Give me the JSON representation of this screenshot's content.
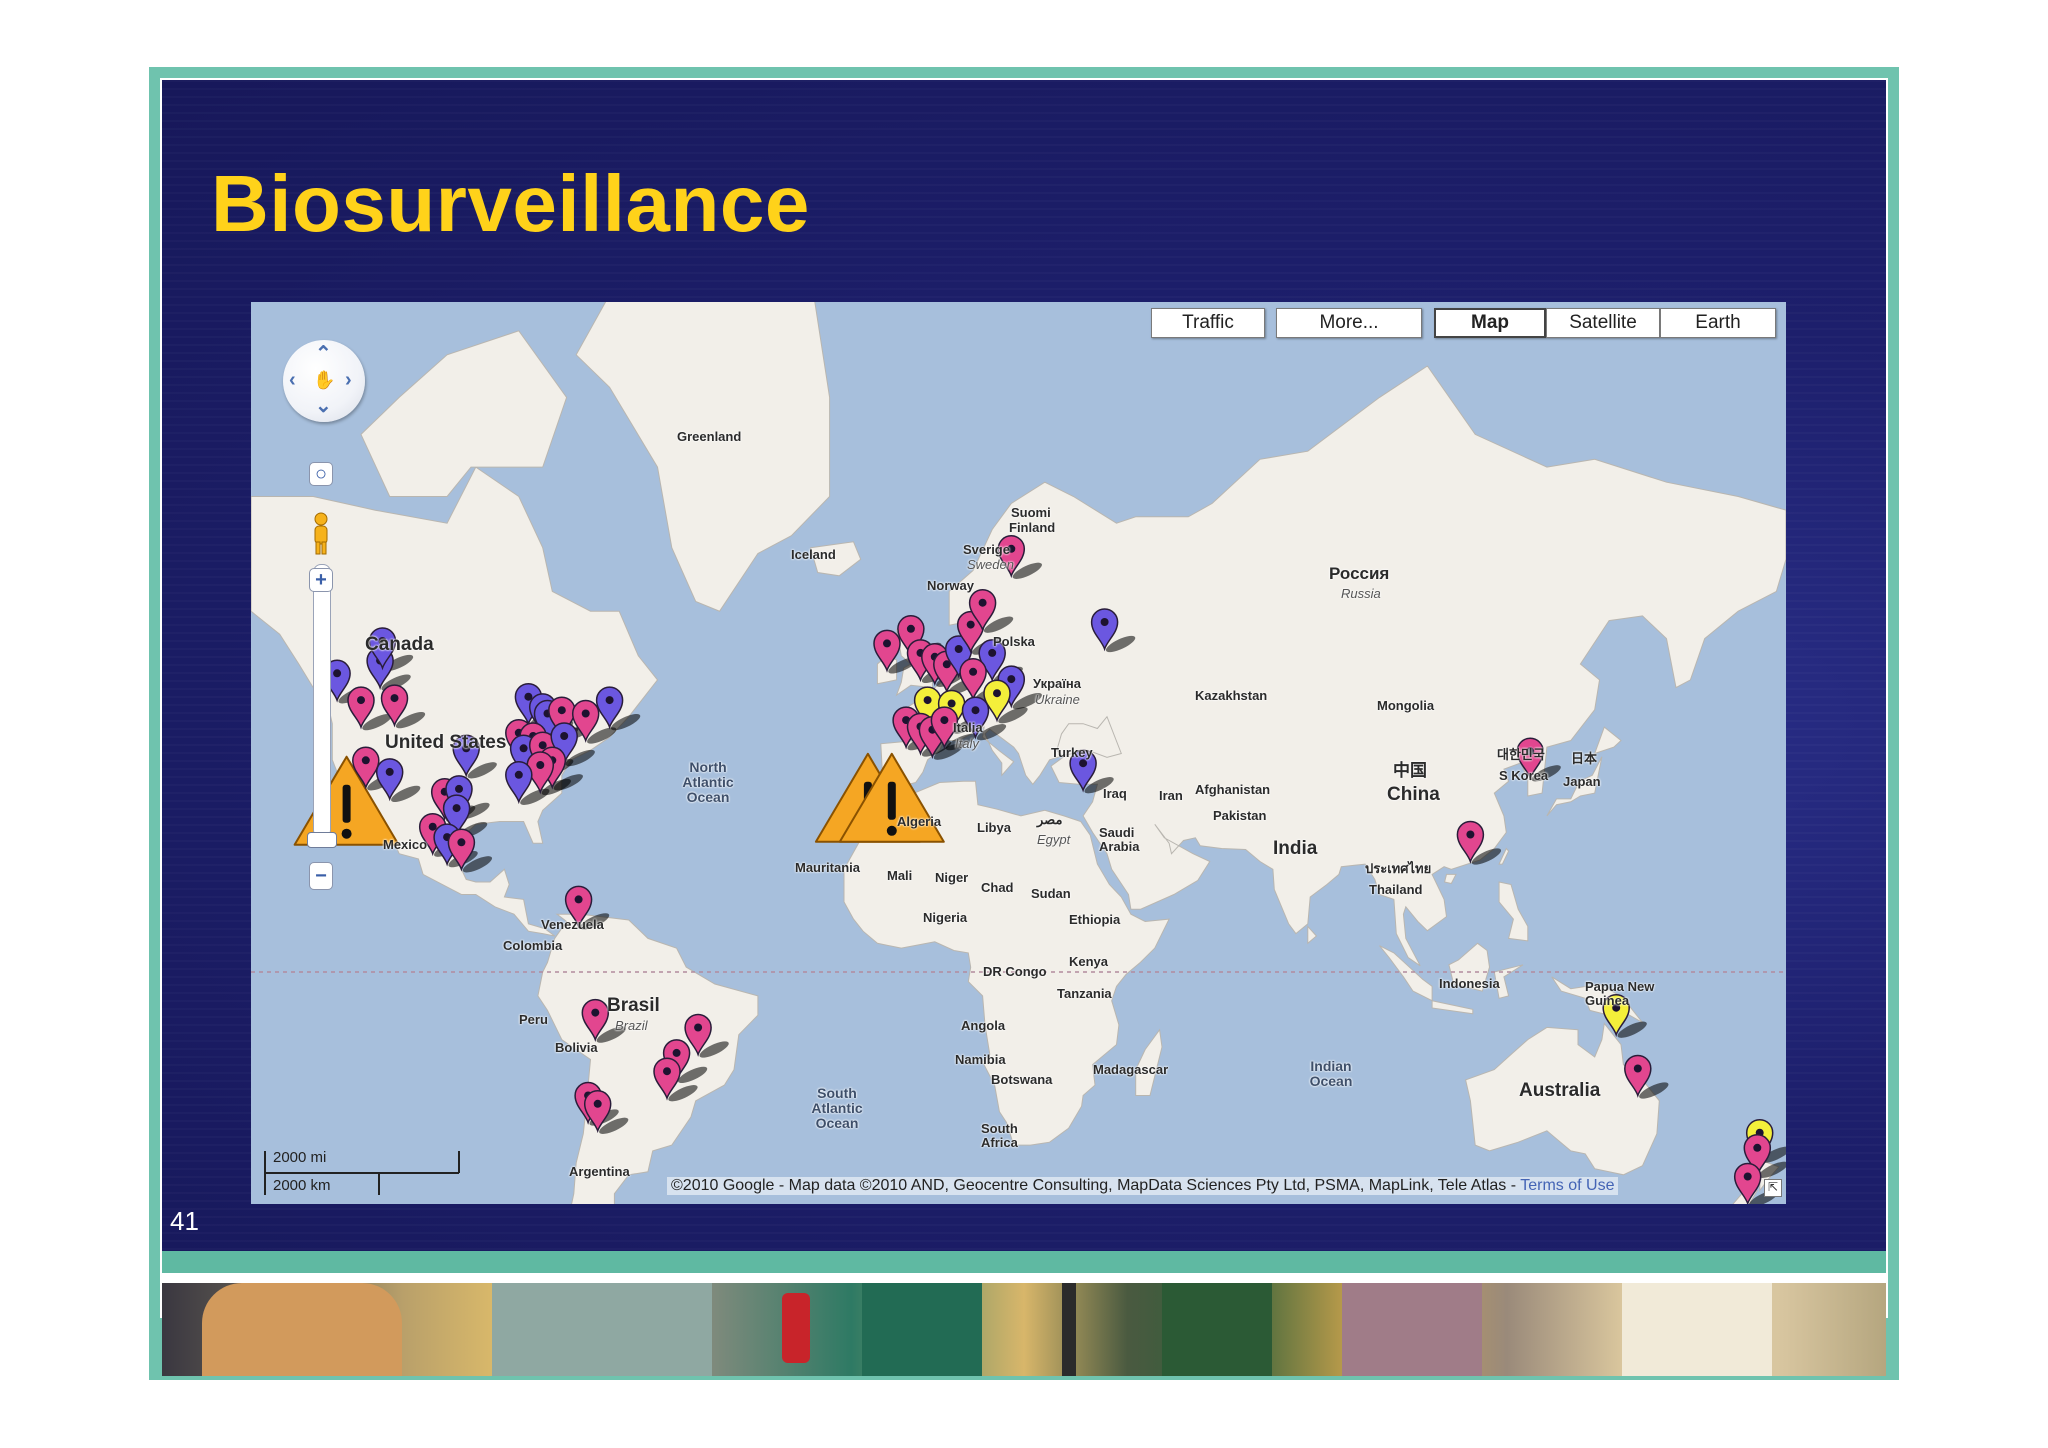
{
  "slide": {
    "title": "Biosurveillance",
    "number": "41"
  },
  "map": {
    "buttons": {
      "traffic": "Traffic",
      "more": "More...",
      "map": "Map",
      "satellite": "Satellite",
      "earth": "Earth",
      "active": "Map"
    },
    "labels": {
      "greenland": "Greenland",
      "iceland": "Iceland",
      "canada": "Canada",
      "united_states": "United States",
      "mexico": "Mexico",
      "venezuela": "Venezuela",
      "colombia": "Colombia",
      "peru": "Peru",
      "bolivia": "Bolivia",
      "brasil": "Brasil",
      "brazil": "Brazil",
      "argentina": "Argentina",
      "north_atlantic": "North Atlantic Ocean",
      "south_atlantic": "South Atlantic Ocean",
      "suomi": "Suomi",
      "finland": "Finland",
      "sverige": "Sverige",
      "sweden": "Sweden",
      "norway": "Norway",
      "polska": "Polska",
      "ukraina_native": "Україна",
      "ukraine": "Ukraine",
      "italia": "Italia",
      "italy": "Italy",
      "turkey": "Turkey",
      "iraq": "Iraq",
      "iran": "Iran",
      "afghanistan": "Afghanistan",
      "pakistan": "Pakistan",
      "kazakhstan": "Kazakhstan",
      "mongolia": "Mongolia",
      "rossiya": "Россия",
      "russia": "Russia",
      "china_native": "中国",
      "china": "China",
      "korea_native": "대한민국",
      "s_korea": "S Korea",
      "japan_native": "日本",
      "japan": "Japan",
      "india": "India",
      "thailand_native": "ประเทศไทย",
      "thailand": "Thailand",
      "indonesia": "Indonesia",
      "papua": "Papua New Guinea",
      "australia": "Australia",
      "indian_ocean": "Indian Ocean",
      "algeria": "Algeria",
      "libya": "Libya",
      "egypt_native": "مصر",
      "egypt": "Egypt",
      "saudi": "Saudi Arabia",
      "mauritania": "Mauritania",
      "mali": "Mali",
      "niger": "Niger",
      "chad": "Chad",
      "sudan": "Sudan",
      "ethiopia": "Ethiopia",
      "nigeria": "Nigeria",
      "kenya": "Kenya",
      "dr_congo": "DR Congo",
      "tanzania": "Tanzania",
      "angola": "Angola",
      "namibia": "Namibia",
      "botswana": "Botswana",
      "madagascar": "Madagascar",
      "south_africa": "South Africa"
    },
    "scale": {
      "imperial": "2000 mi",
      "metric": "2000 km"
    },
    "attribution": {
      "text": "©2010 Google - Map data ©2010 AND, Geocentre Consulting, MapData Sciences Pty Ltd, PSMA, MapLink, Tele Atlas - ",
      "terms": "Terms of Use"
    },
    "marker_colors": {
      "purple": "#6b57e0",
      "pink": "#e2468f",
      "yellow": "#f4ef3a",
      "warning": "#f5a623"
    },
    "markers": [
      {
        "color": "purple",
        "lon": -123.0,
        "lat": 49.3
      },
      {
        "color": "purple",
        "lon": -114.0,
        "lat": 51.0
      },
      {
        "color": "purple",
        "lon": -113.5,
        "lat": 53.5
      },
      {
        "color": "pink",
        "lon": -118.0,
        "lat": 45.5
      },
      {
        "color": "pink",
        "lon": -111.0,
        "lat": 45.8
      },
      {
        "color": "purple",
        "lon": -96.0,
        "lat": 38.0
      },
      {
        "color": "purple",
        "lon": -83.0,
        "lat": 46.0
      },
      {
        "color": "purple",
        "lon": -80.0,
        "lat": 44.5
      },
      {
        "color": "purple",
        "lon": -79.0,
        "lat": 43.5
      },
      {
        "color": "pink",
        "lon": -76.0,
        "lat": 44.0
      },
      {
        "color": "pink",
        "lon": -71.0,
        "lat": 43.5
      },
      {
        "color": "purple",
        "lon": -66.0,
        "lat": 45.5
      },
      {
        "color": "pink",
        "lon": -85.0,
        "lat": 40.5
      },
      {
        "color": "pink",
        "lon": -82.0,
        "lat": 40.0
      },
      {
        "color": "purple",
        "lon": -84.0,
        "lat": 38.0
      },
      {
        "color": "pink",
        "lon": -80.0,
        "lat": 38.5
      },
      {
        "color": "purple",
        "lon": -75.5,
        "lat": 40.0
      },
      {
        "color": "pink",
        "lon": -78.0,
        "lat": 36.0
      },
      {
        "color": "pink",
        "lon": -80.5,
        "lat": 35.2
      },
      {
        "color": "purple",
        "lon": -85.0,
        "lat": 33.5
      },
      {
        "color": "pink",
        "lon": -117.0,
        "lat": 36.0
      },
      {
        "color": "purple",
        "lon": -112.0,
        "lat": 34.0
      },
      {
        "color": "pink",
        "lon": -100.5,
        "lat": 30.5
      },
      {
        "color": "purple",
        "lon": -97.5,
        "lat": 31.0
      },
      {
        "color": "purple",
        "lon": -98.0,
        "lat": 27.5
      },
      {
        "color": "pink",
        "lon": -103.0,
        "lat": 24.0
      },
      {
        "color": "purple",
        "lon": -100.0,
        "lat": 22.0
      },
      {
        "color": "pink",
        "lon": -97.0,
        "lat": 21.0
      },
      {
        "color": "pink",
        "lon": -72.5,
        "lat": 9.5
      },
      {
        "color": "pink",
        "lon": -69.0,
        "lat": -14.0
      },
      {
        "color": "pink",
        "lon": -70.5,
        "lat": -30.0
      },
      {
        "color": "pink",
        "lon": -68.5,
        "lat": -31.5
      },
      {
        "color": "pink",
        "lon": -47.5,
        "lat": -17.0
      },
      {
        "color": "pink",
        "lon": -52.0,
        "lat": -22.0
      },
      {
        "color": "pink",
        "lon": -54.0,
        "lat": -25.5
      },
      {
        "color": "pink",
        "lon": -8.0,
        "lat": 53.2
      },
      {
        "color": "pink",
        "lon": -3.0,
        "lat": 55.0
      },
      {
        "color": "pink",
        "lon": -1.0,
        "lat": 52.0
      },
      {
        "color": "pink",
        "lon": 2.0,
        "lat": 51.5
      },
      {
        "color": "pink",
        "lon": 4.5,
        "lat": 50.5
      },
      {
        "color": "purple",
        "lon": 7.0,
        "lat": 52.5
      },
      {
        "color": "pink",
        "lon": 9.5,
        "lat": 55.5
      },
      {
        "color": "pink",
        "lon": 12.0,
        "lat": 58.0
      },
      {
        "color": "pink",
        "lon": 18.0,
        "lat": 63.5
      },
      {
        "color": "purple",
        "lon": 14.0,
        "lat": 52.0
      },
      {
        "color": "pink",
        "lon": 10.0,
        "lat": 49.5
      },
      {
        "color": "purple",
        "lon": 18.0,
        "lat": 48.5
      },
      {
        "color": "yellow",
        "lon": 0.5,
        "lat": 45.5
      },
      {
        "color": "yellow",
        "lon": 5.5,
        "lat": 45.0
      },
      {
        "color": "yellow",
        "lon": 15.0,
        "lat": 46.5
      },
      {
        "color": "pink",
        "lon": -4.0,
        "lat": 42.5
      },
      {
        "color": "pink",
        "lon": -1.0,
        "lat": 41.5
      },
      {
        "color": "pink",
        "lon": 1.5,
        "lat": 41.0
      },
      {
        "color": "pink",
        "lon": 4.0,
        "lat": 42.5
      },
      {
        "color": "purple",
        "lon": 10.5,
        "lat": 44.0
      },
      {
        "color": "purple",
        "lon": 37.5,
        "lat": 55.8
      },
      {
        "color": "purple",
        "lon": 33.0,
        "lat": 35.5
      },
      {
        "color": "pink",
        "lon": 126.5,
        "lat": 37.5
      },
      {
        "color": "pink",
        "lon": 114.0,
        "lat": 22.5
      },
      {
        "color": "yellow",
        "lon": 144.5,
        "lat": -13.0
      },
      {
        "color": "pink",
        "lon": 149.0,
        "lat": -25.0
      },
      {
        "color": "yellow",
        "lon": 174.5,
        "lat": -36.5
      },
      {
        "color": "pink",
        "lon": 174.0,
        "lat": -39.0
      },
      {
        "color": "pink",
        "lon": 172.0,
        "lat": -43.5
      }
    ],
    "warnings": [
      {
        "lon": -121.0,
        "lat": 33.0
      },
      {
        "lon": -12.0,
        "lat": 33.5
      },
      {
        "lon": -7.0,
        "lat": 33.5
      }
    ]
  }
}
